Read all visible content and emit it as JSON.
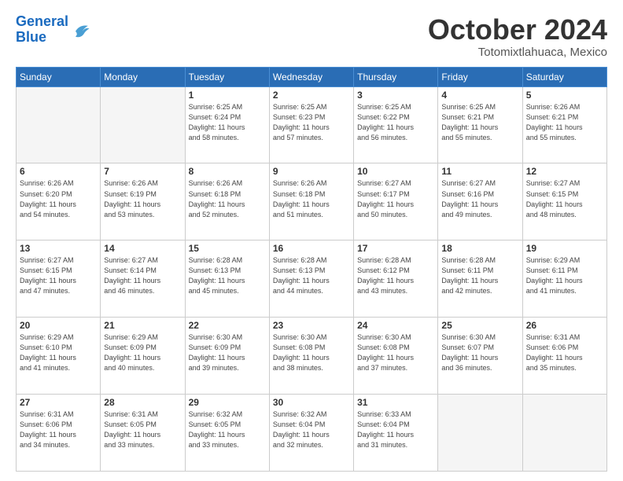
{
  "header": {
    "logo_line1": "General",
    "logo_line2": "Blue",
    "month": "October 2024",
    "location": "Totomixtlahuaca, Mexico"
  },
  "weekdays": [
    "Sunday",
    "Monday",
    "Tuesday",
    "Wednesday",
    "Thursday",
    "Friday",
    "Saturday"
  ],
  "weeks": [
    [
      {
        "day": "",
        "info": ""
      },
      {
        "day": "",
        "info": ""
      },
      {
        "day": "1",
        "info": "Sunrise: 6:25 AM\nSunset: 6:24 PM\nDaylight: 11 hours\nand 58 minutes."
      },
      {
        "day": "2",
        "info": "Sunrise: 6:25 AM\nSunset: 6:23 PM\nDaylight: 11 hours\nand 57 minutes."
      },
      {
        "day": "3",
        "info": "Sunrise: 6:25 AM\nSunset: 6:22 PM\nDaylight: 11 hours\nand 56 minutes."
      },
      {
        "day": "4",
        "info": "Sunrise: 6:25 AM\nSunset: 6:21 PM\nDaylight: 11 hours\nand 55 minutes."
      },
      {
        "day": "5",
        "info": "Sunrise: 6:26 AM\nSunset: 6:21 PM\nDaylight: 11 hours\nand 55 minutes."
      }
    ],
    [
      {
        "day": "6",
        "info": "Sunrise: 6:26 AM\nSunset: 6:20 PM\nDaylight: 11 hours\nand 54 minutes."
      },
      {
        "day": "7",
        "info": "Sunrise: 6:26 AM\nSunset: 6:19 PM\nDaylight: 11 hours\nand 53 minutes."
      },
      {
        "day": "8",
        "info": "Sunrise: 6:26 AM\nSunset: 6:18 PM\nDaylight: 11 hours\nand 52 minutes."
      },
      {
        "day": "9",
        "info": "Sunrise: 6:26 AM\nSunset: 6:18 PM\nDaylight: 11 hours\nand 51 minutes."
      },
      {
        "day": "10",
        "info": "Sunrise: 6:27 AM\nSunset: 6:17 PM\nDaylight: 11 hours\nand 50 minutes."
      },
      {
        "day": "11",
        "info": "Sunrise: 6:27 AM\nSunset: 6:16 PM\nDaylight: 11 hours\nand 49 minutes."
      },
      {
        "day": "12",
        "info": "Sunrise: 6:27 AM\nSunset: 6:15 PM\nDaylight: 11 hours\nand 48 minutes."
      }
    ],
    [
      {
        "day": "13",
        "info": "Sunrise: 6:27 AM\nSunset: 6:15 PM\nDaylight: 11 hours\nand 47 minutes."
      },
      {
        "day": "14",
        "info": "Sunrise: 6:27 AM\nSunset: 6:14 PM\nDaylight: 11 hours\nand 46 minutes."
      },
      {
        "day": "15",
        "info": "Sunrise: 6:28 AM\nSunset: 6:13 PM\nDaylight: 11 hours\nand 45 minutes."
      },
      {
        "day": "16",
        "info": "Sunrise: 6:28 AM\nSunset: 6:13 PM\nDaylight: 11 hours\nand 44 minutes."
      },
      {
        "day": "17",
        "info": "Sunrise: 6:28 AM\nSunset: 6:12 PM\nDaylight: 11 hours\nand 43 minutes."
      },
      {
        "day": "18",
        "info": "Sunrise: 6:28 AM\nSunset: 6:11 PM\nDaylight: 11 hours\nand 42 minutes."
      },
      {
        "day": "19",
        "info": "Sunrise: 6:29 AM\nSunset: 6:11 PM\nDaylight: 11 hours\nand 41 minutes."
      }
    ],
    [
      {
        "day": "20",
        "info": "Sunrise: 6:29 AM\nSunset: 6:10 PM\nDaylight: 11 hours\nand 41 minutes."
      },
      {
        "day": "21",
        "info": "Sunrise: 6:29 AM\nSunset: 6:09 PM\nDaylight: 11 hours\nand 40 minutes."
      },
      {
        "day": "22",
        "info": "Sunrise: 6:30 AM\nSunset: 6:09 PM\nDaylight: 11 hours\nand 39 minutes."
      },
      {
        "day": "23",
        "info": "Sunrise: 6:30 AM\nSunset: 6:08 PM\nDaylight: 11 hours\nand 38 minutes."
      },
      {
        "day": "24",
        "info": "Sunrise: 6:30 AM\nSunset: 6:08 PM\nDaylight: 11 hours\nand 37 minutes."
      },
      {
        "day": "25",
        "info": "Sunrise: 6:30 AM\nSunset: 6:07 PM\nDaylight: 11 hours\nand 36 minutes."
      },
      {
        "day": "26",
        "info": "Sunrise: 6:31 AM\nSunset: 6:06 PM\nDaylight: 11 hours\nand 35 minutes."
      }
    ],
    [
      {
        "day": "27",
        "info": "Sunrise: 6:31 AM\nSunset: 6:06 PM\nDaylight: 11 hours\nand 34 minutes."
      },
      {
        "day": "28",
        "info": "Sunrise: 6:31 AM\nSunset: 6:05 PM\nDaylight: 11 hours\nand 33 minutes."
      },
      {
        "day": "29",
        "info": "Sunrise: 6:32 AM\nSunset: 6:05 PM\nDaylight: 11 hours\nand 33 minutes."
      },
      {
        "day": "30",
        "info": "Sunrise: 6:32 AM\nSunset: 6:04 PM\nDaylight: 11 hours\nand 32 minutes."
      },
      {
        "day": "31",
        "info": "Sunrise: 6:33 AM\nSunset: 6:04 PM\nDaylight: 11 hours\nand 31 minutes."
      },
      {
        "day": "",
        "info": ""
      },
      {
        "day": "",
        "info": ""
      }
    ]
  ]
}
